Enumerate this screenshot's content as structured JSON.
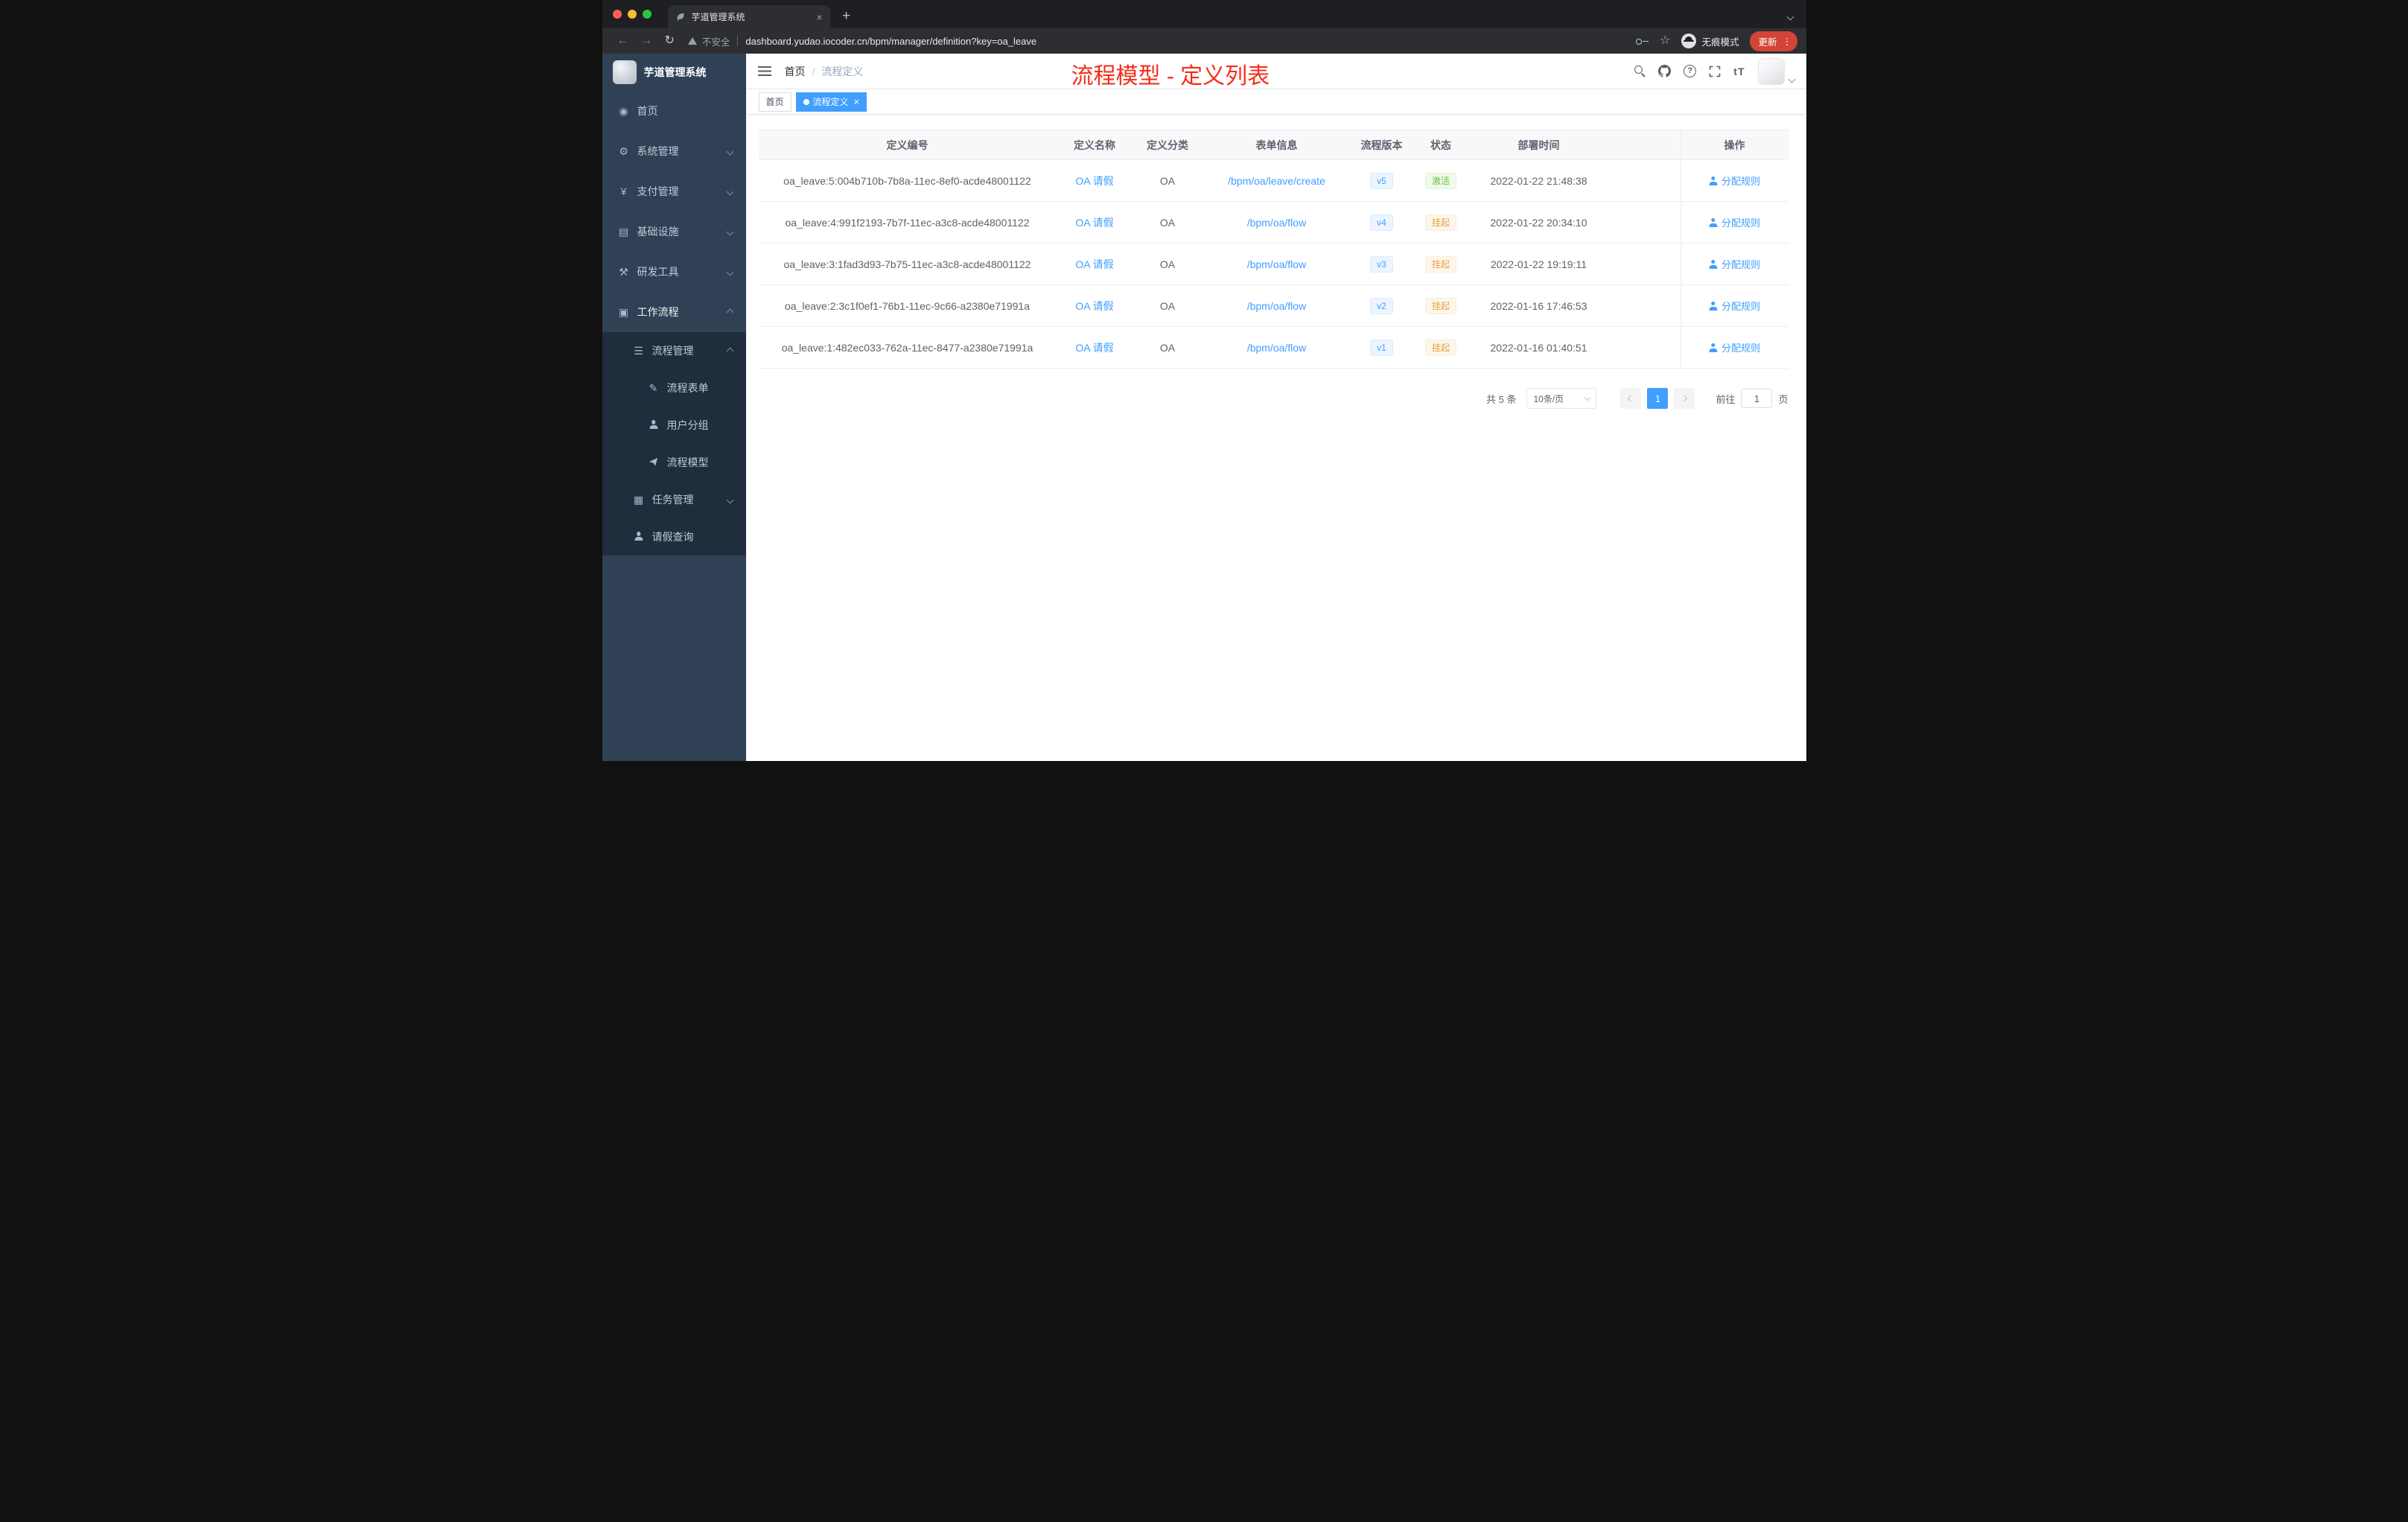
{
  "colors": {
    "accent_blue": "#409eff",
    "success_green": "#67c23a",
    "warning_orange": "#e6a23c",
    "annotation_red": "#f62c17",
    "sidebar_bg": "#304156",
    "sidebar_submenu_bg": "#1f2d3d"
  },
  "browser": {
    "tab_title": "芋道管理系统",
    "security_label": "不安全",
    "url": "dashboard.yudao.iocoder.cn/bpm/manager/definition?key=oa_leave",
    "incognito_label": "无痕模式",
    "update_label": "更新"
  },
  "sidebar": {
    "app_title": "芋道管理系统",
    "items": [
      {
        "label": "首页",
        "icon": "dashboard-icon"
      },
      {
        "label": "系统管理",
        "icon": "gear-icon"
      },
      {
        "label": "支付管理",
        "icon": "yen-icon"
      },
      {
        "label": "基础设施",
        "icon": "server-icon"
      },
      {
        "label": "研发工具",
        "icon": "tool-icon"
      },
      {
        "label": "工作流程",
        "icon": "workflow-icon"
      }
    ],
    "submenu": {
      "process_mgmt": {
        "label": "流程管理",
        "icon": "list-icon"
      },
      "children": [
        {
          "label": "流程表单",
          "icon": "form-icon"
        },
        {
          "label": "用户分组",
          "icon": "users-icon"
        },
        {
          "label": "流程模型",
          "icon": "send-icon"
        }
      ],
      "task_mgmt": {
        "label": "任务管理",
        "icon": "task-icon"
      },
      "leave_query": {
        "label": "请假查询",
        "icon": "user-icon"
      }
    }
  },
  "navbar": {
    "breadcrumb_home": "首页",
    "breadcrumb_sep": "/",
    "breadcrumb_current": "流程定义",
    "annotation": "流程模型 - 定义列表",
    "font_size_icon": "tT"
  },
  "tags": [
    {
      "label": "首页",
      "active": false
    },
    {
      "label": "流程定义",
      "active": true
    }
  ],
  "table": {
    "columns": {
      "id": "定义编号",
      "name": "定义名称",
      "category": "定义分类",
      "form": "表单信息",
      "version": "流程版本",
      "status": "状态",
      "deploy_time": "部署时间",
      "action": "操作"
    },
    "rows": [
      {
        "id": "oa_leave:5:004b710b-7b8a-11ec-8ef0-acde48001122",
        "name": "OA 请假",
        "category": "OA",
        "form": "/bpm/oa/leave/create",
        "version": "v5",
        "status": "激活",
        "status_type": "active",
        "deploy_time": "2022-01-22 21:48:38",
        "action": "分配规则"
      },
      {
        "id": "oa_leave:4:991f2193-7b7f-11ec-a3c8-acde48001122",
        "name": "OA 请假",
        "category": "OA",
        "form": "/bpm/oa/flow",
        "version": "v4",
        "status": "挂起",
        "status_type": "suspended",
        "deploy_time": "2022-01-22 20:34:10",
        "action": "分配规则"
      },
      {
        "id": "oa_leave:3:1fad3d93-7b75-11ec-a3c8-acde48001122",
        "name": "OA 请假",
        "category": "OA",
        "form": "/bpm/oa/flow",
        "version": "v3",
        "status": "挂起",
        "status_type": "suspended",
        "deploy_time": "2022-01-22 19:19:11",
        "action": "分配规则"
      },
      {
        "id": "oa_leave:2:3c1f0ef1-76b1-11ec-9c66-a2380e71991a",
        "name": "OA 请假",
        "category": "OA",
        "form": "/bpm/oa/flow",
        "version": "v2",
        "status": "挂起",
        "status_type": "suspended",
        "deploy_time": "2022-01-16 17:46:53",
        "action": "分配规则"
      },
      {
        "id": "oa_leave:1:482ec033-762a-11ec-8477-a2380e71991a",
        "name": "OA 请假",
        "category": "OA",
        "form": "/bpm/oa/flow",
        "version": "v1",
        "status": "挂起",
        "status_type": "suspended",
        "deploy_time": "2022-01-16 01:40:51",
        "action": "分配规则"
      }
    ]
  },
  "pagination": {
    "total": "共 5 条",
    "page_size": "10条/页",
    "current_page": "1",
    "goto_label": "前往",
    "goto_value": "1",
    "unit_label": "页"
  }
}
